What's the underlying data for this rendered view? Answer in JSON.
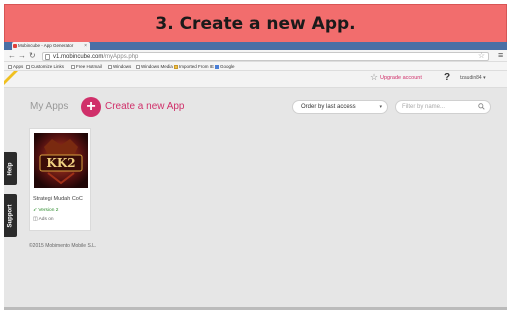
{
  "banner": {
    "title": "3. Create a new App."
  },
  "browser": {
    "tab_title": "Mobincube - App Generator",
    "url_host": "v1.mobincube.com",
    "url_path": "/myApps.php",
    "bookmarks": [
      "Apps",
      "Customize Links",
      "Free Hotmail",
      "Windows",
      "Windows Media",
      "Imported From IE",
      "Google"
    ]
  },
  "app": {
    "upgrade_label": "Upgrade account",
    "help_label": "?",
    "username": "tzaudin84 ▾",
    "my_apps_label": "My Apps",
    "create_label": "Create a new App",
    "order_by": "Order by last access",
    "filter_placeholder": "Filter by name...",
    "side_help": "Help",
    "side_support": "Support",
    "card": {
      "name": "Strategi Mudah CoC",
      "version": "Version 2",
      "ads": "Ads on",
      "logo_text": "KK2"
    },
    "footer": "©2015 Mobimento Mobile S.L."
  },
  "colors": {
    "accent": "#d0306a",
    "banner": "#f26d6d",
    "background": "#e6e6e6"
  }
}
